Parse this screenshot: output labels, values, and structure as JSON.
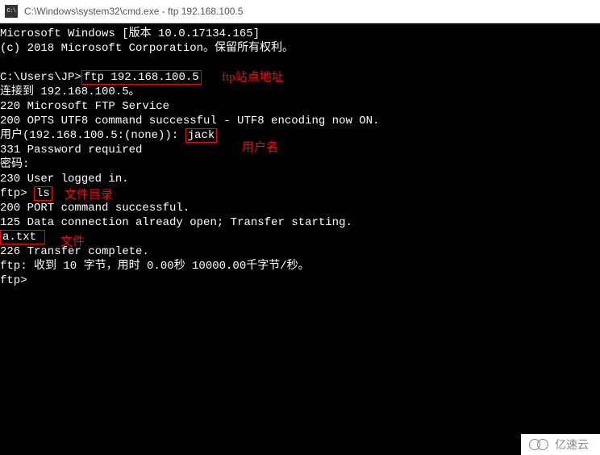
{
  "titlebar": {
    "icon_label": "C:\\",
    "title": "C:\\Windows\\system32\\cmd.exe - ftp  192.168.100.5"
  },
  "terminal": {
    "line1": "Microsoft Windows [版本 10.0.17134.165]",
    "line2": "(c) 2018 Microsoft Corporation。保留所有权利。",
    "line3_prefix": "C:\\Users\\JP>",
    "line3_cmd": "ftp 192.168.100.5",
    "line4": "连接到 192.168.100.5。",
    "line5": "220 Microsoft FTP Service",
    "line6": "200 OPTS UTF8 command successful - UTF8 encoding now ON.",
    "line7_prefix": "用户(192.168.100.5:(none)): ",
    "line7_user": "jack",
    "line8": "331 Password required",
    "line9": "密码:",
    "line10": "230 User logged in.",
    "line11_prefix": "ftp> ",
    "line11_cmd": "ls",
    "line12": "200 PORT command successful.",
    "line13": "125 Data connection already open; Transfer starting.",
    "line14_file": "a.txt ",
    "line15": "226 Transfer complete.",
    "line16": "ftp: 收到 10 字节，用时 0.00秒 10000.00千字节/秒。",
    "line17": "ftp>"
  },
  "annotations": {
    "ftp_addr": "ftp站点地址",
    "username": "用户名",
    "dirlist": "文件目录",
    "file": "文件"
  },
  "watermark": {
    "text": "亿速云"
  }
}
